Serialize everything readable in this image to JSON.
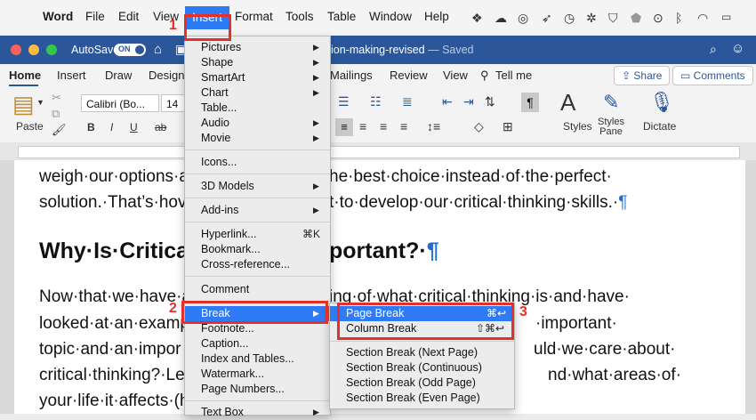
{
  "menubar": {
    "app": "Word",
    "items": [
      "File",
      "Edit",
      "View",
      "Insert",
      "Format",
      "Tools",
      "Table",
      "Window",
      "Help"
    ]
  },
  "window": {
    "autosave_label": "AutoSave",
    "autosave_state": "ON",
    "doc_title": "ion-making-revised",
    "doc_status": "— Saved"
  },
  "ribbon": {
    "tabs": [
      "Home",
      "Insert",
      "Draw",
      "Design",
      "Mailings",
      "Review",
      "View"
    ],
    "tell_me": "Tell me",
    "share": "Share",
    "comments": "Comments",
    "paste": "Paste",
    "font_name": "Calibri (Bo...",
    "font_size": "14",
    "styles": "Styles",
    "styles_pane_1": "Styles",
    "styles_pane_2": "Pane",
    "dictate": "Dictate",
    "bold": "B",
    "italic": "I",
    "underline": "U"
  },
  "document": {
    "line1": "weigh·our·options·a",
    "line1b": "he·best·choice·instead·of·the·perfect·",
    "line2": "solution.·That’s·hov",
    "line2b": "t·to·develop·our·critical·thinking·skills.·",
    "heading_a": "Why·Is·Critica",
    "heading_b": "portant?·",
    "p1a": "Now·that·we·have·a",
    "p1b": "ing·of·what·critical·thinking·is·and·have·",
    "p2a": "looked·at·an·examp",
    "p2b": "·important·",
    "p3a": "topic·and·an·impor",
    "p3b": "uld·we·care·about·",
    "p4a": "critical·thinking?·Let",
    "p4b": "nd·what·areas·of·",
    "p5a": "your·life·it·affects·(h",
    "pilcrow": "¶"
  },
  "insert_menu": {
    "items": [
      "Pictures",
      "Shape",
      "SmartArt",
      "Chart",
      "Table...",
      "Audio",
      "Movie",
      "Icons...",
      "3D Models",
      "Add-ins",
      "Hyperlink...",
      "Bookmark...",
      "Cross-reference...",
      "Comment",
      "Break",
      "Footnote...",
      "Caption...",
      "Index and Tables...",
      "Watermark...",
      "Page Numbers...",
      "Text Box"
    ],
    "hyperlink_shortcut": "⌘K"
  },
  "break_submenu": {
    "items": [
      "Page Break",
      "Column Break",
      "Section Break (Next Page)",
      "Section Break (Continuous)",
      "Section Break (Odd Page)",
      "Section Break (Even Page)"
    ],
    "page_break_shortcut": "⌘↩",
    "column_break_shortcut": "⇧⌘↩"
  },
  "steps": [
    "1",
    "2",
    "3"
  ],
  "colors": {
    "word_blue": "#2b579a",
    "highlight": "#2f7bf5",
    "annotation_red": "#e3302a"
  }
}
